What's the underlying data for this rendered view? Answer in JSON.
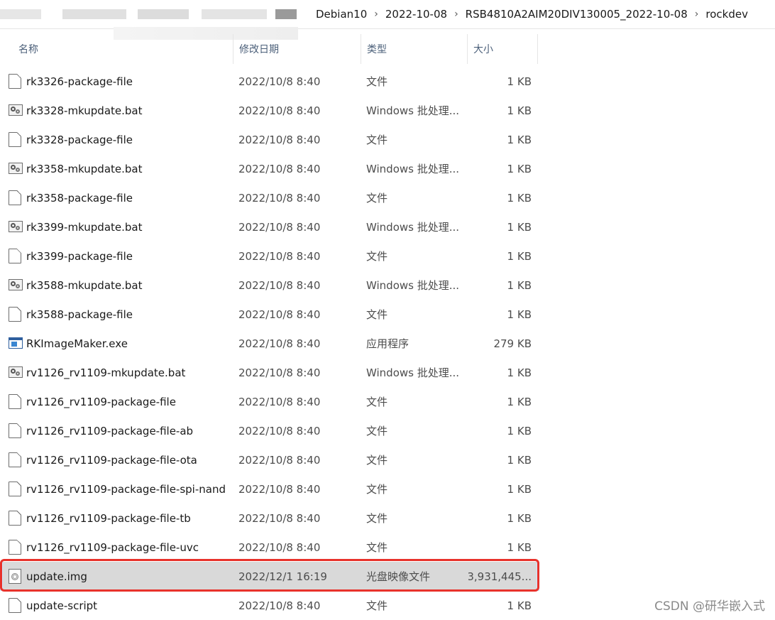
{
  "breadcrumb": {
    "items": [
      "Debian10",
      "2022-10-08",
      "RSB4810A2AIM20DIV130005_2022-10-08",
      "rockdev"
    ],
    "separator": "›"
  },
  "columns": {
    "name": "名称",
    "date": "修改日期",
    "type": "类型",
    "size": "大小"
  },
  "files": [
    {
      "name": "rk3326-package-file",
      "date": "2022/10/8 8:40",
      "type": "文件",
      "size": "1 KB",
      "icon": "file"
    },
    {
      "name": "rk3328-mkupdate.bat",
      "date": "2022/10/8 8:40",
      "type": "Windows 批处理...",
      "size": "1 KB",
      "icon": "bat"
    },
    {
      "name": "rk3328-package-file",
      "date": "2022/10/8 8:40",
      "type": "文件",
      "size": "1 KB",
      "icon": "file"
    },
    {
      "name": "rk3358-mkupdate.bat",
      "date": "2022/10/8 8:40",
      "type": "Windows 批处理...",
      "size": "1 KB",
      "icon": "bat"
    },
    {
      "name": "rk3358-package-file",
      "date": "2022/10/8 8:40",
      "type": "文件",
      "size": "1 KB",
      "icon": "file"
    },
    {
      "name": "rk3399-mkupdate.bat",
      "date": "2022/10/8 8:40",
      "type": "Windows 批处理...",
      "size": "1 KB",
      "icon": "bat"
    },
    {
      "name": "rk3399-package-file",
      "date": "2022/10/8 8:40",
      "type": "文件",
      "size": "1 KB",
      "icon": "file"
    },
    {
      "name": "rk3588-mkupdate.bat",
      "date": "2022/10/8 8:40",
      "type": "Windows 批处理...",
      "size": "1 KB",
      "icon": "bat"
    },
    {
      "name": "rk3588-package-file",
      "date": "2022/10/8 8:40",
      "type": "文件",
      "size": "1 KB",
      "icon": "file"
    },
    {
      "name": "RKImageMaker.exe",
      "date": "2022/10/8 8:40",
      "type": "应用程序",
      "size": "279 KB",
      "icon": "exe"
    },
    {
      "name": "rv1126_rv1109-mkupdate.bat",
      "date": "2022/10/8 8:40",
      "type": "Windows 批处理...",
      "size": "1 KB",
      "icon": "bat"
    },
    {
      "name": "rv1126_rv1109-package-file",
      "date": "2022/10/8 8:40",
      "type": "文件",
      "size": "1 KB",
      "icon": "file"
    },
    {
      "name": "rv1126_rv1109-package-file-ab",
      "date": "2022/10/8 8:40",
      "type": "文件",
      "size": "1 KB",
      "icon": "file"
    },
    {
      "name": "rv1126_rv1109-package-file-ota",
      "date": "2022/10/8 8:40",
      "type": "文件",
      "size": "1 KB",
      "icon": "file"
    },
    {
      "name": "rv1126_rv1109-package-file-spi-nand",
      "date": "2022/10/8 8:40",
      "type": "文件",
      "size": "1 KB",
      "icon": "file"
    },
    {
      "name": "rv1126_rv1109-package-file-tb",
      "date": "2022/10/8 8:40",
      "type": "文件",
      "size": "1 KB",
      "icon": "file"
    },
    {
      "name": "rv1126_rv1109-package-file-uvc",
      "date": "2022/10/8 8:40",
      "type": "文件",
      "size": "1 KB",
      "icon": "file"
    },
    {
      "name": "update.img",
      "date": "2022/12/1 16:19",
      "type": "光盘映像文件",
      "size": "3,931,445...",
      "icon": "img",
      "selected": true
    },
    {
      "name": "update-script",
      "date": "2022/10/8 8:40",
      "type": "文件",
      "size": "1 KB",
      "icon": "file"
    }
  ],
  "watermark": "CSDN @研华嵌入式",
  "colors": {
    "header_text": "#4c607a",
    "selected_row": "#d9d9d9",
    "highlight_border": "#e8322b"
  }
}
